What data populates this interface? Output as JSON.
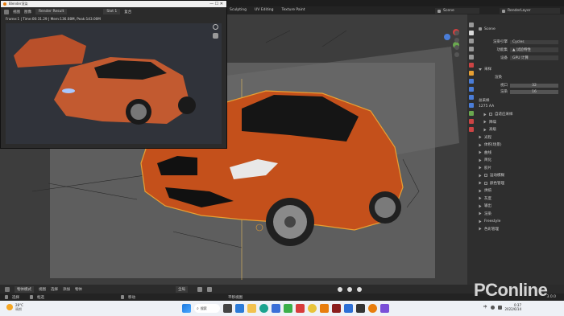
{
  "viewport": {
    "header_tabs": [
      "Sculpting",
      "UV Editing",
      "Texture Paint"
    ],
    "scene_label": "Scene",
    "layer_label": "RenderLayer"
  },
  "render_window": {
    "title": "Blender渲染",
    "menu": [
      "视图",
      "图像"
    ],
    "image_name": "Render Result",
    "slot": "Slot 1",
    "view_layer": "复合",
    "stats": "Frame:1 | Time:00:31.29 | Mem:136.08M, Peak:143.00M"
  },
  "properties": {
    "scene_name": "Scene",
    "engine_label": "渲染引擎",
    "engine_value": "Cycles",
    "feature_label": "功能集",
    "feature_value": "试验特性",
    "device_label": "设备",
    "device_value": "GPU 计算",
    "sampling_label": "采样",
    "viewport_label": "视口",
    "render_label": "渲染",
    "viewport_samples": "32",
    "render_samples": "16",
    "total_label": "总采样",
    "total_value": "1275 AA",
    "sections": [
      "自适应采样",
      "降噪",
      "高级",
      "光程",
      "体积(场景)",
      "曲线",
      "简化",
      "胶片",
      "运动模糊",
      "颜色管理",
      "烘焙",
      "灰度",
      "输出",
      "渲染",
      "Freestyle",
      "色彩管理"
    ]
  },
  "bottom_bar": {
    "mode": "物体模式",
    "menu": [
      "视图",
      "选择",
      "添加",
      "物体"
    ],
    "pivot": "全局",
    "status_left_1": "选择",
    "status_left_2": "框选",
    "status_mid": "移动",
    "status_right": "平移视图",
    "version": "3.0.0"
  },
  "taskbar": {
    "weather_temp": "28°C",
    "weather_desc": "晴朗",
    "search": "搜索",
    "time": "0:37",
    "date": "2022/6/14",
    "lang": "中"
  },
  "watermark": "PConline",
  "colors": {
    "car": "#c4501b",
    "select_outline": "#e8a033",
    "blender_bg": "#3d3d3d"
  }
}
